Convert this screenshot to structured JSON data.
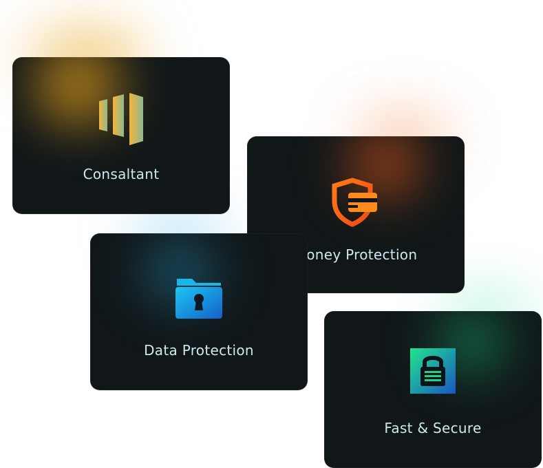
{
  "cards": [
    {
      "label": "Consaltant",
      "icon": "bars-icon",
      "accent": "#e8a31c"
    },
    {
      "label": "Money Protection",
      "icon": "shield-card-icon",
      "accent": "#f06a1c"
    },
    {
      "label": "Data Protection",
      "icon": "folder-lock-icon",
      "accent": "#1cc6f0"
    },
    {
      "label": "Fast & Secure",
      "icon": "padlock-icon",
      "accent": "#1de08a"
    }
  ]
}
